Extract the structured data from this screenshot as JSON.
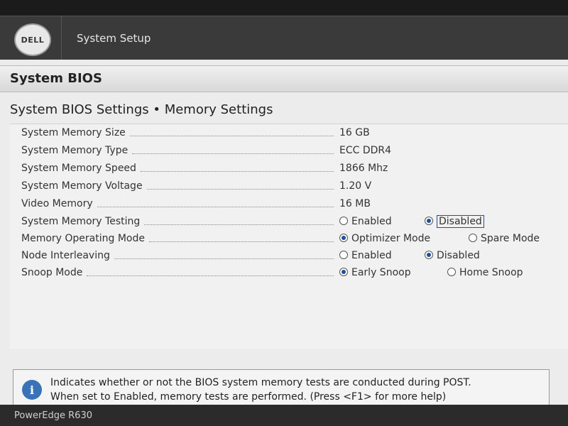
{
  "header": {
    "logo_text": "DELL",
    "title": "System Setup"
  },
  "page": {
    "section_title": "System BIOS",
    "breadcrumb": "System BIOS Settings • Memory Settings"
  },
  "settings": [
    {
      "label": "System Memory Size",
      "value": "16 GB"
    },
    {
      "label": "System Memory Type",
      "value": "ECC DDR4"
    },
    {
      "label": "System Memory Speed",
      "value": "1866 Mhz"
    },
    {
      "label": "System Memory Voltage",
      "value": "1.20 V"
    },
    {
      "label": "Video Memory",
      "value": "16 MB"
    },
    {
      "label": "System Memory Testing",
      "options": [
        "Enabled",
        "Disabled"
      ],
      "selected": "Disabled"
    },
    {
      "label": "Memory Operating Mode",
      "options": [
        "Optimizer Mode",
        "Spare Mode"
      ],
      "selected": "Optimizer Mode"
    },
    {
      "label": "Node Interleaving",
      "options": [
        "Enabled",
        "Disabled"
      ],
      "selected": "Disabled"
    },
    {
      "label": "Snoop Mode",
      "options": [
        "Early Snoop",
        "Home Snoop"
      ],
      "selected": "Early Snoop"
    }
  ],
  "help": {
    "line1": "Indicates whether or not the BIOS system memory tests are conducted during POST.",
    "line2": "When set to Enabled, memory tests are performed. (Press <F1> for more help)"
  },
  "footer": {
    "model": "PowerEdge R630"
  },
  "colors": {
    "accent": "#1f4e9c",
    "info_icon": "#3a72b8"
  },
  "icons": {
    "info": "info-icon",
    "logo": "dell-logo-icon"
  }
}
